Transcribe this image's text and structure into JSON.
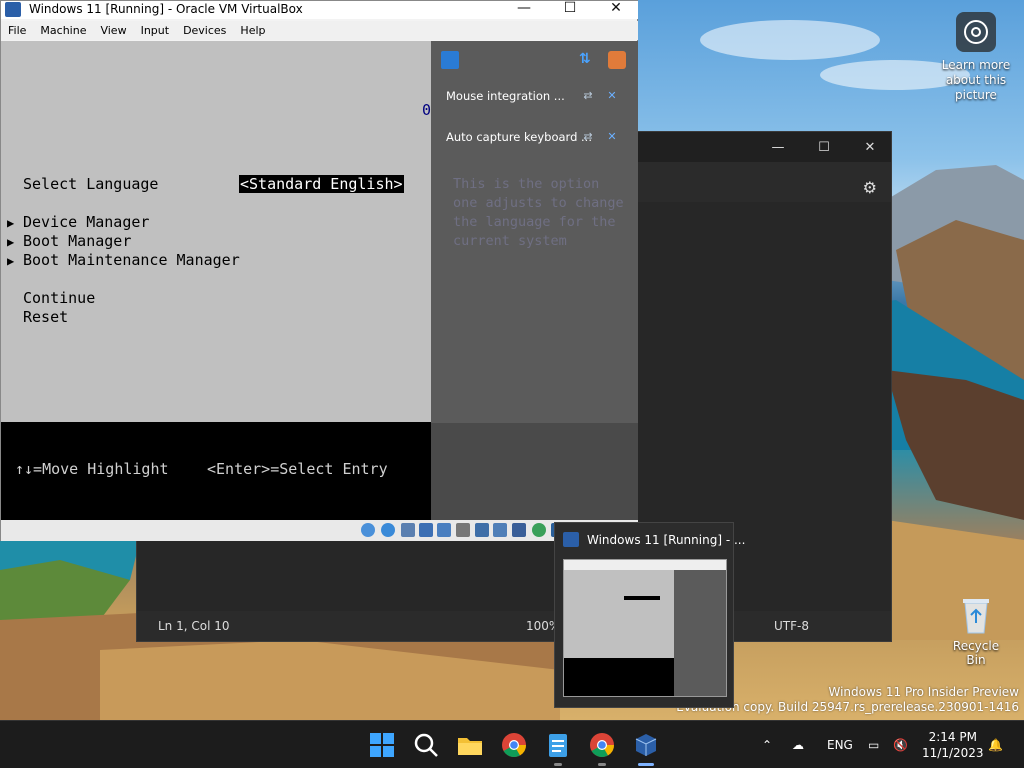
{
  "colors": {
    "vbox_blue": "#2b5fa8",
    "uefi_gray": "#c0c0c0",
    "uefi_highlight": "#000000",
    "help_text": "#6f6f83",
    "taskbar": "#1c1c1c",
    "dark_window": "#272727",
    "active_indicator": "#7fb3ff"
  },
  "desktop": {
    "learn_more_label": "Learn more about this picture",
    "learn_more_icon": "camera-icon",
    "recycle_bin_label": "Recycle Bin",
    "recycle_bin_icon": "recycle-bin-icon",
    "watermark_line1": "Windows 11 Pro Insider Preview",
    "watermark_line2": "Evaluation copy. Build 25947.rs_prerelease.230901-1416"
  },
  "dark_window": {
    "settings_icon": "gear-icon",
    "status_position": "Ln 1, Col 10",
    "status_zoom": "100%",
    "status_encoding": "UTF-8"
  },
  "vbox": {
    "title": "Windows 11 [Running] - Oracle VM VirtualBox",
    "menu": [
      "File",
      "Machine",
      "View",
      "Input",
      "Devices",
      "Help"
    ],
    "uefi": {
      "select_language_label": "Select Language",
      "select_language_value": "<Standard English>",
      "top_value": "0",
      "menu_items": [
        "Device Manager",
        "Boot Manager",
        "Boot Maintenance Manager"
      ],
      "actions": [
        "Continue",
        "Reset"
      ],
      "footer_left": "↑↓=Move Highlight",
      "footer_right": "<Enter>=Select Entry"
    },
    "notifications": {
      "items": [
        "Mouse integration ...",
        "Auto capture keyboard ..."
      ]
    },
    "help_text": "This is the option\none adjusts to change\nthe language for the\ncurrent system"
  },
  "preview": {
    "title": "Windows 11 [Running] - ..."
  },
  "taskbar": {
    "apps": [
      "start-icon",
      "search-icon",
      "file-explorer-icon",
      "chrome-icon",
      "notepad-icon",
      "chrome-icon",
      "virtualbox-icon"
    ],
    "tray_language": "ENG",
    "time": "2:14 PM",
    "date": "11/1/2023"
  }
}
